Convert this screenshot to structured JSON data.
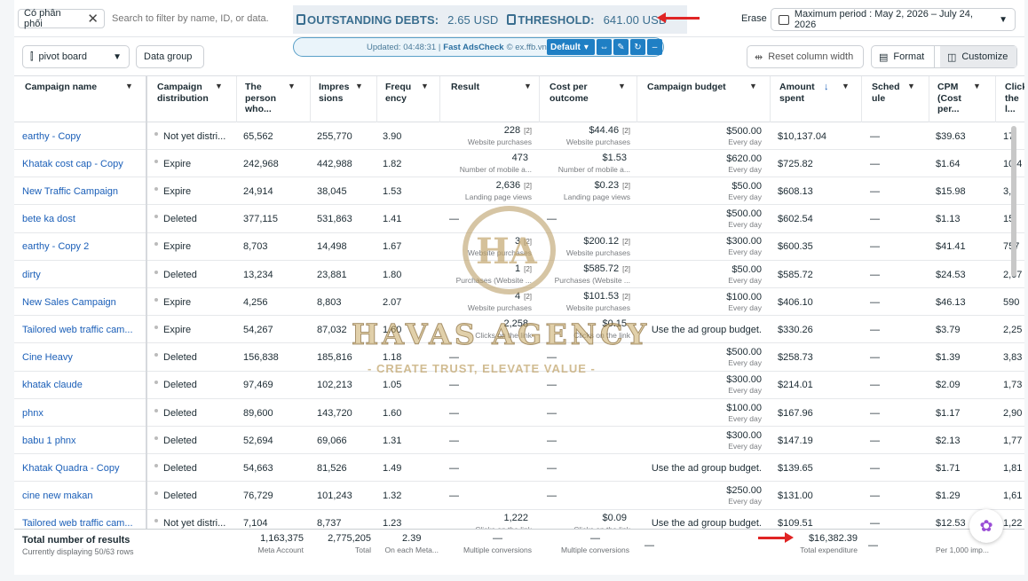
{
  "toolbar": {
    "filter_chip": "Có phân phối",
    "search_placeholder": "Search to filter by name, ID, or data.",
    "outstanding_label": "OUTSTANDING DEBTS:",
    "outstanding_value": "2.65 USD",
    "threshold_label": "THRESHOLD:",
    "threshold_value": "641.00 USD",
    "erase": "Erase",
    "period": "Maximum period : May 2, 2026 – July 24, 2026"
  },
  "actions": {
    "pivot": "pivot board",
    "data_group": "Data group",
    "reset": "Reset column width",
    "format": "Format",
    "customize": "Customize"
  },
  "extension": {
    "updated": "Updated: 04:48:31 |",
    "name": "Fast AdsCheck",
    "domain": "© ex.ffb.vn",
    "preset": "Default"
  },
  "columns": [
    {
      "label": "Campaign name"
    },
    {
      "label": "Campaign distribution"
    },
    {
      "label": "The person who..."
    },
    {
      "label": "Impres sions"
    },
    {
      "label": "Frequ ency"
    },
    {
      "label": "Result"
    },
    {
      "label": "Cost per outcome"
    },
    {
      "label": "Campaign budget"
    },
    {
      "label": "Amount spent"
    },
    {
      "label": "Sched ule"
    },
    {
      "label": "CPM (Cost per..."
    },
    {
      "label": "Click the l..."
    }
  ],
  "rows": [
    {
      "name": "earthy - Copy",
      "dist": "Not yet distri...",
      "reach": "65,562",
      "impr": "255,770",
      "freq": "3.90",
      "result": "228",
      "result_n": "[2]",
      "result_sub": "Website purchases",
      "cost": "$44.46",
      "cost_n": "[2]",
      "cost_sub": "Website purchases",
      "budget": "$500.00",
      "budget_sub": "Every day",
      "spent": "$10,137.04",
      "sched": "—",
      "cpm": "$39.63",
      "click": "17,"
    },
    {
      "name": "Khatak cost cap - Copy",
      "dist": "Expire",
      "reach": "242,968",
      "impr": "442,988",
      "freq": "1.82",
      "result": "473",
      "result_n": "",
      "result_sub": "Number of mobile a...",
      "cost": "$1.53",
      "cost_n": "",
      "cost_sub": "Number of mobile a...",
      "budget": "$620.00",
      "budget_sub": "Every day",
      "spent": "$725.82",
      "sched": "—",
      "cpm": "$1.64",
      "click": "10,4"
    },
    {
      "name": "New Traffic Campaign",
      "dist": "Expire",
      "reach": "24,914",
      "impr": "38,045",
      "freq": "1.53",
      "result": "2,636",
      "result_n": "[2]",
      "result_sub": "Landing page views",
      "cost": "$0.23",
      "cost_n": "[2]",
      "cost_sub": "Landing page views",
      "budget": "$50.00",
      "budget_sub": "Every day",
      "spent": "$608.13",
      "sched": "—",
      "cpm": "$15.98",
      "click": "3,2"
    },
    {
      "name": "bete ka dost",
      "dist": "Deleted",
      "reach": "377,115",
      "impr": "531,863",
      "freq": "1.41",
      "result": "—",
      "result_n": "",
      "result_sub": "",
      "cost": "—",
      "cost_n": "",
      "cost_sub": "",
      "budget": "$500.00",
      "budget_sub": "Every day",
      "spent": "$602.54",
      "sched": "—",
      "cpm": "$1.13",
      "click": "15,"
    },
    {
      "name": "earthy - Copy 2",
      "dist": "Expire",
      "reach": "8,703",
      "impr": "14,498",
      "freq": "1.67",
      "result": "3",
      "result_n": "[2]",
      "result_sub": "Website purchases",
      "cost": "$200.12",
      "cost_n": "[2]",
      "cost_sub": "Website purchases",
      "budget": "$300.00",
      "budget_sub": "Every day",
      "spent": "$600.35",
      "sched": "—",
      "cpm": "$41.41",
      "click": "757"
    },
    {
      "name": "dirty",
      "dist": "Deleted",
      "reach": "13,234",
      "impr": "23,881",
      "freq": "1.80",
      "result": "1",
      "result_n": "[2]",
      "result_sub": "Purchases (Website ...",
      "cost": "$585.72",
      "cost_n": "[2]",
      "cost_sub": "Purchases (Website ...",
      "budget": "$50.00",
      "budget_sub": "Every day",
      "spent": "$585.72",
      "sched": "—",
      "cpm": "$24.53",
      "click": "2,07"
    },
    {
      "name": "New Sales Campaign",
      "dist": "Expire",
      "reach": "4,256",
      "impr": "8,803",
      "freq": "2.07",
      "result": "4",
      "result_n": "[2]",
      "result_sub": "Website purchases",
      "cost": "$101.53",
      "cost_n": "[2]",
      "cost_sub": "Website purchases",
      "budget": "$100.00",
      "budget_sub": "Every day",
      "spent": "$406.10",
      "sched": "—",
      "cpm": "$46.13",
      "click": "590"
    },
    {
      "name": "Tailored web traffic cam...",
      "dist": "Expire",
      "reach": "54,267",
      "impr": "87,032",
      "freq": "1.60",
      "result": "2,258",
      "result_n": "",
      "result_sub": "Clicks on the link",
      "cost": "$0.15",
      "cost_n": "",
      "cost_sub": "Clicks on the link",
      "budget": "Use the ad group budget.",
      "budget_sub": "",
      "spent": "$330.26",
      "sched": "—",
      "cpm": "$3.79",
      "click": "2,25"
    },
    {
      "name": "Cine Heavy",
      "dist": "Deleted",
      "reach": "156,838",
      "impr": "185,816",
      "freq": "1.18",
      "result": "—",
      "result_n": "",
      "result_sub": "",
      "cost": "—",
      "cost_n": "",
      "cost_sub": "",
      "budget": "$500.00",
      "budget_sub": "Every day",
      "spent": "$258.73",
      "sched": "—",
      "cpm": "$1.39",
      "click": "3,83"
    },
    {
      "name": "khatak claude",
      "dist": "Deleted",
      "reach": "97,469",
      "impr": "102,213",
      "freq": "1.05",
      "result": "—",
      "result_n": "",
      "result_sub": "",
      "cost": "—",
      "cost_n": "",
      "cost_sub": "",
      "budget": "$300.00",
      "budget_sub": "Every day",
      "spent": "$214.01",
      "sched": "—",
      "cpm": "$2.09",
      "click": "1,73"
    },
    {
      "name": "phnx",
      "dist": "Deleted",
      "reach": "89,600",
      "impr": "143,720",
      "freq": "1.60",
      "result": "—",
      "result_n": "",
      "result_sub": "",
      "cost": "—",
      "cost_n": "",
      "cost_sub": "",
      "budget": "$100.00",
      "budget_sub": "Every day",
      "spent": "$167.96",
      "sched": "—",
      "cpm": "$1.17",
      "click": "2,90"
    },
    {
      "name": "babu 1 phnx",
      "dist": "Deleted",
      "reach": "52,694",
      "impr": "69,066",
      "freq": "1.31",
      "result": "—",
      "result_n": "",
      "result_sub": "",
      "cost": "—",
      "cost_n": "",
      "cost_sub": "",
      "budget": "$300.00",
      "budget_sub": "Every day",
      "spent": "$147.19",
      "sched": "—",
      "cpm": "$2.13",
      "click": "1,77"
    },
    {
      "name": "Khatak Quadra - Copy",
      "dist": "Deleted",
      "reach": "54,663",
      "impr": "81,526",
      "freq": "1.49",
      "result": "—",
      "result_n": "",
      "result_sub": "",
      "cost": "—",
      "cost_n": "",
      "cost_sub": "",
      "budget": "Use the ad group budget.",
      "budget_sub": "",
      "spent": "$139.65",
      "sched": "—",
      "cpm": "$1.71",
      "click": "1,81"
    },
    {
      "name": "cine new makan",
      "dist": "Deleted",
      "reach": "76,729",
      "impr": "101,243",
      "freq": "1.32",
      "result": "—",
      "result_n": "",
      "result_sub": "",
      "cost": "—",
      "cost_n": "",
      "cost_sub": "",
      "budget": "$250.00",
      "budget_sub": "Every day",
      "spent": "$131.00",
      "sched": "—",
      "cpm": "$1.29",
      "click": "1,61"
    },
    {
      "name": "Tailored web traffic cam...",
      "dist": "Not yet distri...",
      "reach": "7,104",
      "impr": "8,737",
      "freq": "1.23",
      "result": "1,222",
      "result_n": "",
      "result_sub": "Clicks on the link",
      "cost": "$0.09",
      "cost_n": "",
      "cost_sub": "Clicks on the link",
      "budget": "Use the ad group budget.",
      "budget_sub": "",
      "spent": "$109.51",
      "sched": "—",
      "cpm": "$12.53",
      "click": "1,22"
    }
  ],
  "footer": {
    "title": "Total number of results",
    "subtitle": "Currently displaying 50/63 rows",
    "reach": "1,163,375",
    "reach_sub": "Meta Account",
    "impr": "2,775,205",
    "impr_sub": "Total",
    "freq": "2.39",
    "freq_sub": "On each Meta...",
    "result": "—",
    "result_sub": "Multiple conversions",
    "cost": "—",
    "cost_sub": "Multiple conversions",
    "budget": "—",
    "spent": "$16,382.39",
    "spent_sub": "Total expenditure",
    "sched": "—",
    "cpm": "$5",
    "cpm_sub": "Per 1,000 imp..."
  },
  "watermark": {
    "mark": "HA",
    "name": "HAVAS AGENCY",
    "tagline": "- CREATE TRUST, ELEVATE VALUE -"
  },
  "colors": {
    "accent": "#1b5fb8",
    "warning": "#e02424",
    "debt": "#3a6e8f"
  }
}
